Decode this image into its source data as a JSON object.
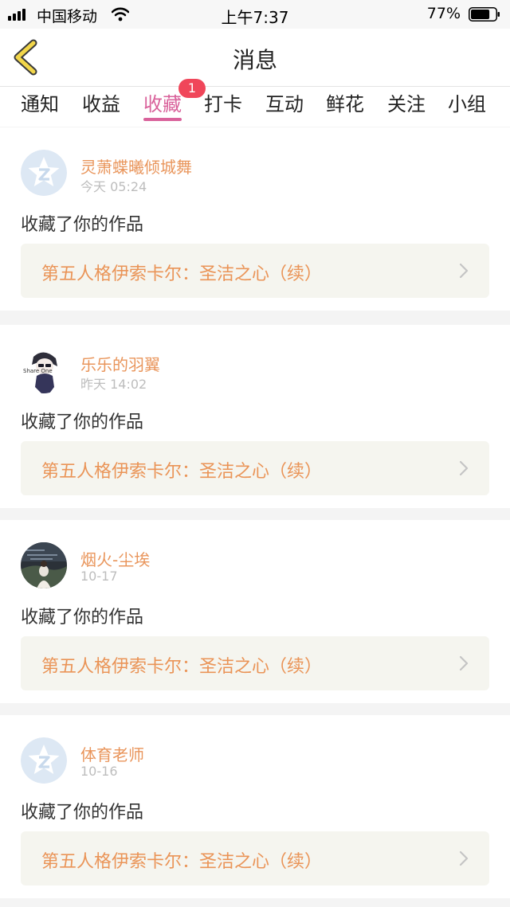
{
  "status_bar": {
    "carrier": "中国移动",
    "time": "上午7:37",
    "battery": "77%",
    "battery_level": 0.77
  },
  "nav": {
    "title": "消息",
    "back_icon": "chevron-left-icon"
  },
  "tabs": [
    {
      "label": "通知"
    },
    {
      "label": "收益"
    },
    {
      "label": "收藏",
      "active": true,
      "badge": "1"
    },
    {
      "label": "打卡"
    },
    {
      "label": "互动"
    },
    {
      "label": "鲜花"
    },
    {
      "label": "关注"
    },
    {
      "label": "小组"
    }
  ],
  "colors": {
    "accent": "#d9629b",
    "name": "#e9955b",
    "badge": "#f0465a"
  },
  "messages": [
    {
      "user": "灵萧蝶曦倾城舞",
      "time": "今天 05:24",
      "avatar": "default-avatar-icon",
      "action": "收藏了你的作品",
      "work": "第五人格伊索卡尔：圣洁之心（续）"
    },
    {
      "user": "乐乐的羽翼",
      "time": "昨天 14:02",
      "avatar": "anime-avatar-icon",
      "avatar_text": "Share One",
      "action": "收藏了你的作品",
      "work": "第五人格伊索卡尔：圣洁之心（续）"
    },
    {
      "user": "烟火-尘埃",
      "time": "10-17",
      "avatar": "photo-avatar-icon",
      "action": "收藏了你的作品",
      "work": "第五人格伊索卡尔：圣洁之心（续）"
    },
    {
      "user": "体育老师",
      "time": "10-16",
      "avatar": "default-avatar-icon",
      "action": "收藏了你的作品",
      "work": "第五人格伊索卡尔：圣洁之心（续）"
    }
  ]
}
